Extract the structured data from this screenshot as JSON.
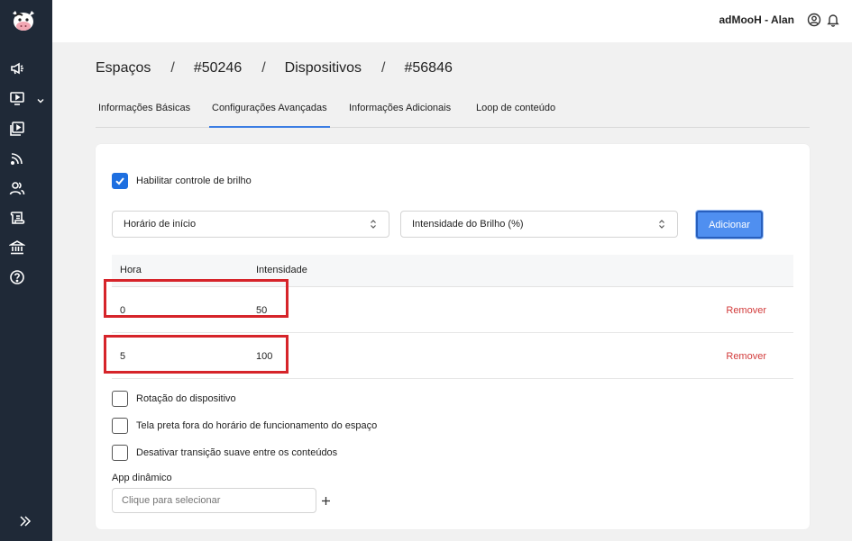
{
  "sidebar": {
    "items": [
      {
        "icon": "megaphone-icon"
      },
      {
        "icon": "monitor-play-icon",
        "has_caret": true
      },
      {
        "icon": "playlist-icon"
      },
      {
        "icon": "feed-icon"
      },
      {
        "icon": "users-icon"
      },
      {
        "icon": "scroll-icon"
      },
      {
        "icon": "bank-icon"
      },
      {
        "icon": "help-icon"
      }
    ],
    "collapse_icon": "double-chevron-right-icon"
  },
  "header": {
    "user_label": "adMooH - Alan"
  },
  "breadcrumb": [
    "Espaços",
    "#50246",
    "Dispositivos",
    "#56846"
  ],
  "tabs": [
    {
      "label": "Informações Básicas",
      "active": false
    },
    {
      "label": "Configurações Avançadas",
      "active": true
    },
    {
      "label": "Informações Adicionais",
      "active": false
    },
    {
      "label": "Loop de conteúdo",
      "active": false
    }
  ],
  "brightness": {
    "enable_label": "Habilitar controle de brilho",
    "enabled": true,
    "start_select": "Horário de início",
    "intensity_select": "Intensidade do Brilho (%)",
    "add_label": "Adicionar",
    "columns": [
      "Hora",
      "Intensidade"
    ],
    "rows": [
      {
        "hour": "0",
        "intensity": "50",
        "action": "Remover"
      },
      {
        "hour": "5",
        "intensity": "100",
        "action": "Remover"
      }
    ]
  },
  "options": [
    {
      "label": "Rotação do dispositivo",
      "checked": false
    },
    {
      "label": "Tela preta fora do horário de funcionamento do espaço",
      "checked": false
    },
    {
      "label": "Desativar transição suave entre os conteúdos",
      "checked": false
    }
  ],
  "dynamic_app": {
    "label": "App dinâmico",
    "placeholder": "Clique para selecionar"
  },
  "colors": {
    "sidebar_bg": "#1f2937",
    "accent": "#3b7de3",
    "danger": "#d23b3b",
    "highlight": "#d6242a"
  }
}
